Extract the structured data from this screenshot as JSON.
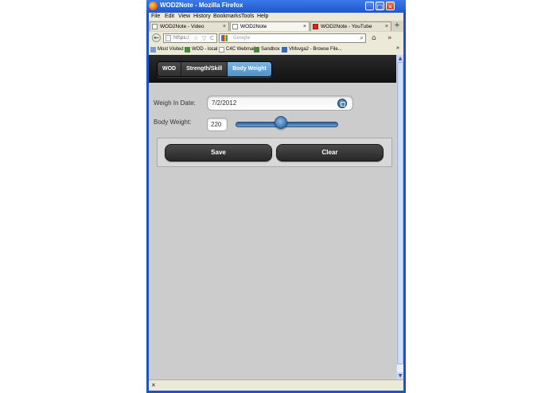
{
  "window": {
    "title": "WOD2Note - Mozilla Firefox",
    "minimize": "_",
    "maximize": "□",
    "close": "×"
  },
  "menu": [
    "File",
    "Edit",
    "View",
    "History",
    "Bookmarks",
    "Tools",
    "Help"
  ],
  "tabs": [
    {
      "label": "WOD2Note - Video",
      "close": "×",
      "active": false
    },
    {
      "label": "WOD2Note",
      "close": "×",
      "active": true
    },
    {
      "label": "WOD2Note - YouTube",
      "close": "×",
      "active": false
    }
  ],
  "new_tab": "+",
  "nav": {
    "back": "←",
    "url": "https:/",
    "star": "☆",
    "dropdown": "▽",
    "reload": "C",
    "search_placeholder": "Google",
    "search_icon": "⌕",
    "home": "⌂",
    "more": "»"
  },
  "bookmarks": [
    "Most Visited",
    "WOD - local",
    "C4C Webmail",
    "Sandbox",
    "VMsvga2 - Browse File..."
  ],
  "bookmarks_more": "»",
  "app": {
    "segments": [
      {
        "label": "WOD",
        "active": false
      },
      {
        "label": "Strength/Skill",
        "active": false
      },
      {
        "label": "Body Weight",
        "active": true
      }
    ],
    "weigh_in_label": "Weigh In Date:",
    "weigh_in_value": "7/2/2012",
    "body_weight_label": "Body Weight:",
    "body_weight_value": "220",
    "slider_level": 0.44,
    "save_label": "Save",
    "clear_label": "Clear"
  },
  "scroll": {
    "up": "▲",
    "down": "▼"
  },
  "status": {
    "close": "×"
  },
  "colors": {
    "active_segment": "#5b9bd0",
    "header_bg": "#1e1e1e",
    "content_bg": "#cccccc",
    "button_bg": "#333333",
    "window_frame": "#1c54c4"
  }
}
